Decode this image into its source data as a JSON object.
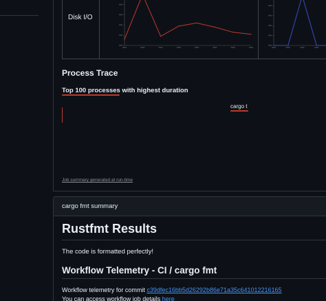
{
  "metrics": {
    "disk_label": "Disk I/O"
  },
  "chart_data": [
    {
      "type": "line",
      "x": [
        0,
        1,
        2,
        3,
        4,
        5,
        6,
        7
      ],
      "series": [
        {
          "values": [
            12,
            100,
            18,
            38,
            44,
            36,
            26,
            22
          ]
        }
      ],
      "color": "#c0392b",
      "grid": true
    },
    {
      "type": "line",
      "x": [
        0,
        1,
        2,
        3,
        4
      ],
      "series": [
        {
          "values": [
            0,
            0,
            100,
            0,
            0
          ]
        }
      ],
      "color": "#3b4cc0",
      "grid": true
    }
  ],
  "process_trace": {
    "title": "Process Trace",
    "subtitle": "Top 100 processes with highest duration",
    "process_label": "cargo t",
    "footnote": "Job summary generated at run-time",
    "accent": "#c0392b"
  },
  "fmt_card": {
    "header": "cargo fmt summary",
    "h1": "Rustfmt Results",
    "result_text": "The code is formatted perfectly!",
    "h2": "Workflow Telemetry - CI / cargo fmt",
    "telemetry_prefix": "Workflow telemetry for commit ",
    "commit_hash": "c39dfec16bb5d26292b86e71a35c641012216165",
    "details_prefix": "You can access workflow job details ",
    "details_link": "here",
    "link_color": "#4493f8"
  }
}
